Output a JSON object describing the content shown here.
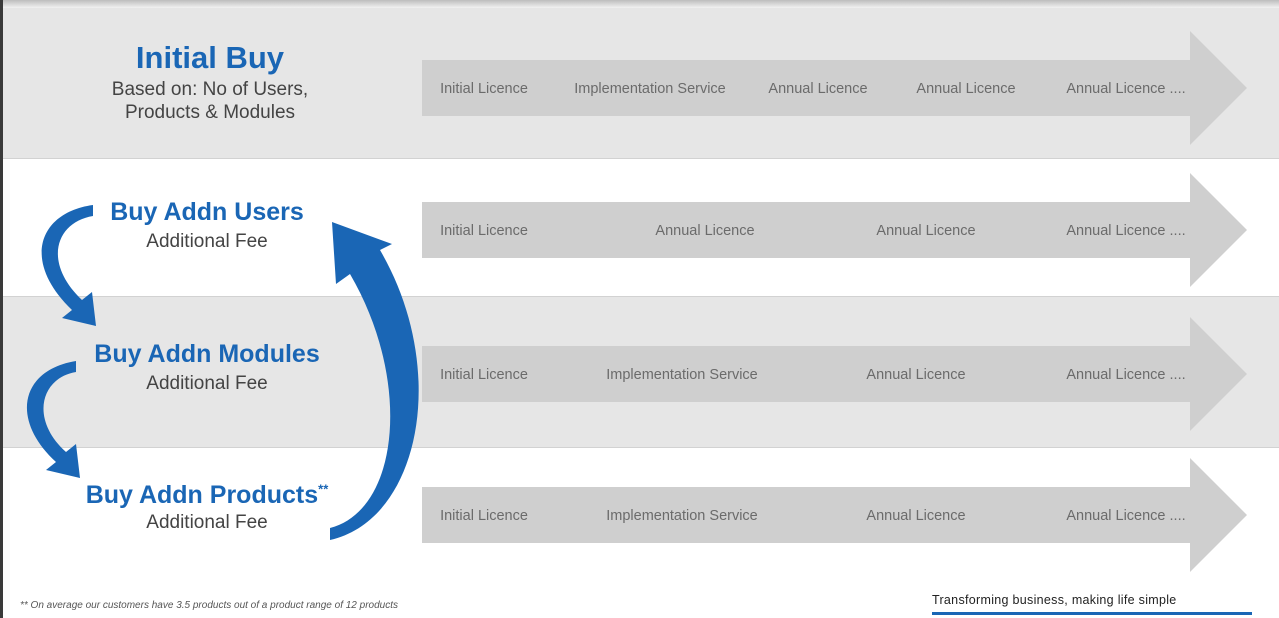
{
  "rows": [
    {
      "title": "Initial Buy",
      "subtitle_lines": [
        "Based on: No of Users,",
        "Products & Modules"
      ],
      "stages": [
        "Initial Licence",
        "Implementation Service",
        "Annual Licence",
        "Annual Licence",
        "Annual Licence ...."
      ]
    },
    {
      "title": "Buy Addn Users",
      "subtitle_lines": [
        "Additional Fee"
      ],
      "stages": [
        "Initial Licence",
        "Annual Licence",
        "Annual Licence",
        "Annual Licence ...."
      ]
    },
    {
      "title": "Buy Addn Modules",
      "subtitle_lines": [
        "Additional Fee"
      ],
      "stages": [
        "Initial Licence",
        "Implementation Service",
        "Annual Licence",
        "Annual Licence ...."
      ]
    },
    {
      "title": "Buy Addn Products",
      "title_mark": "**",
      "subtitle_lines": [
        "Additional Fee"
      ],
      "stages": [
        "Initial Licence",
        "Implementation Service",
        "Annual Licence",
        "Annual Licence ...."
      ]
    }
  ],
  "footnote": "** On average our customers have 3.5 products out of a product range of 12 products",
  "tagline": "Transforming business, making life simple",
  "colors": {
    "accent_blue": "#1a66b5",
    "arrow_gray": "#cfcfcf",
    "band_gray": "#e6e6e6",
    "stage_text": "#6b6b6b"
  }
}
